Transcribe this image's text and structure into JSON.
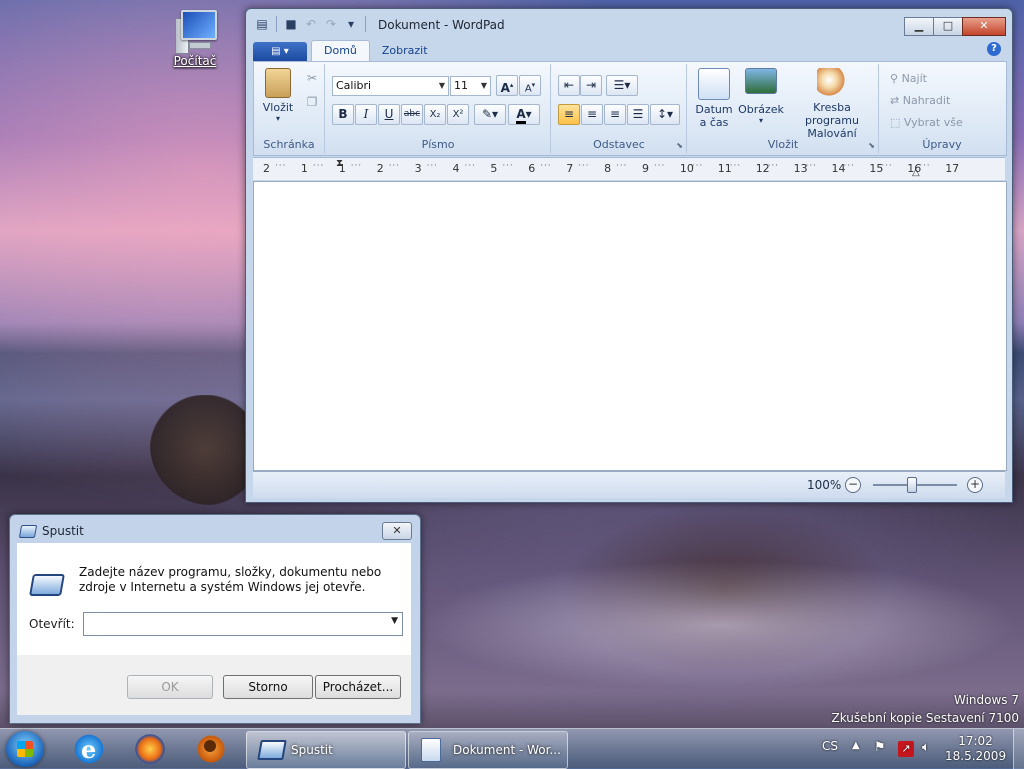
{
  "desktop": {
    "icon_label": "Počítač",
    "watermark_line1": "Windows 7",
    "watermark_line2": "Zkušební kopie Sestavení 7100"
  },
  "wordpad": {
    "title": "Dokument - WordPad",
    "tabs": [
      "Domů",
      "Zobrazit"
    ],
    "groups": {
      "clipboard": {
        "name": "Schránka",
        "paste_label": "Vložit"
      },
      "font": {
        "name": "Písmo",
        "font_family": "Calibri",
        "font_size": "11"
      },
      "paragraph": {
        "name": "Odstavec"
      },
      "insert": {
        "name": "Vložit",
        "datetime_label_1": "Datum",
        "datetime_label_2": "a čas",
        "picture_label": "Obrázek",
        "paint_label_1": "Kresba programu",
        "paint_label_2": "Malování"
      },
      "editing": {
        "name": "Úpravy",
        "find_label": "Najít",
        "replace_label": "Nahradit",
        "select_all_label": "Vybrat vše"
      }
    },
    "ruler_numbers": [
      "2",
      "1",
      "1",
      "2",
      "3",
      "4",
      "5",
      "6",
      "7",
      "8",
      "9",
      "10",
      "11",
      "12",
      "13",
      "14",
      "15",
      "16",
      "17"
    ],
    "zoom": "100%"
  },
  "run_dialog": {
    "title": "Spustit",
    "description": "Zadejte název programu, složky, dokumentu nebo zdroje v Internetu a systém Windows jej otevře.",
    "open_label": "Otevřít:",
    "open_value": "",
    "ok_label": "OK",
    "cancel_label": "Storno",
    "browse_label": "Procházet..."
  },
  "taskbar": {
    "buttons": [
      "Spustit",
      "Dokument - Wor..."
    ],
    "language": "CS",
    "time": "17:02",
    "date": "18.5.2009"
  }
}
